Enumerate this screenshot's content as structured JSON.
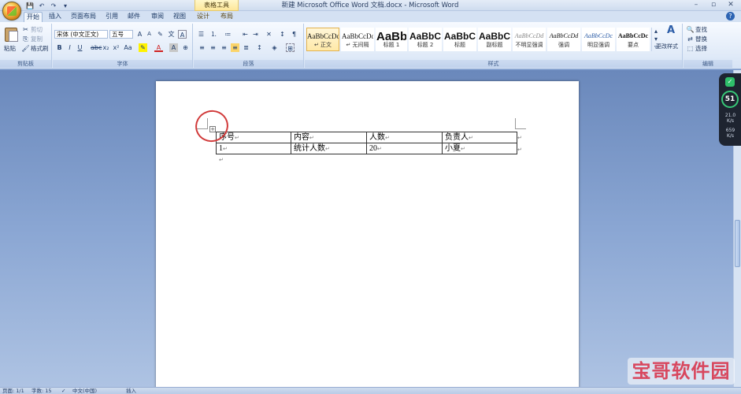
{
  "titlebar": {
    "window_title": "新建 Microsoft Office Word 文档.docx - Microsoft Word",
    "contextual_group": "表格工具",
    "qat": [
      "💾",
      "↶",
      "↷",
      "▾"
    ],
    "controls": [
      "–",
      "▫",
      "✕"
    ]
  },
  "tabs": [
    "开始",
    "插入",
    "页面布局",
    "引用",
    "邮件",
    "审阅",
    "视图",
    "设计",
    "布局"
  ],
  "ribbon": {
    "clipboard": {
      "paste": "粘贴",
      "cut": "剪切",
      "copy": "复制",
      "format_painter": "格式刷",
      "label": "剪贴板"
    },
    "font": {
      "name": "宋体 (中文正文)",
      "size": "五号",
      "label": "字体"
    },
    "paragraph": {
      "label": "段落"
    },
    "styles": {
      "label": "样式",
      "items": [
        {
          "sample": "AaBbCcDd",
          "name": "↵ 正文"
        },
        {
          "sample": "AaBbCcDd",
          "name": "↵ 无间隔"
        },
        {
          "sample": "AaBb",
          "name": "标题 1"
        },
        {
          "sample": "AaBbC",
          "name": "标题 2"
        },
        {
          "sample": "AaBbC",
          "name": "标题"
        },
        {
          "sample": "AaBbC",
          "name": "副标题"
        },
        {
          "sample": "AaBbCcDd",
          "name": "不明显强调"
        },
        {
          "sample": "AaBbCcDd",
          "name": "强调"
        },
        {
          "sample": "AaBbCcDc",
          "name": "明显强调"
        },
        {
          "sample": "AaBbCcDc",
          "name": "要点"
        }
      ],
      "change_styles": "更改样式"
    },
    "editing": {
      "find": "查找",
      "replace": "替换",
      "select": "选择",
      "label": "编辑"
    }
  },
  "table": {
    "rows": [
      [
        "序号",
        "内容",
        "人数",
        "负责人"
      ],
      [
        "1",
        "统计人数",
        "20",
        "小夏"
      ]
    ],
    "cell_mark": "↵"
  },
  "net_widget": {
    "percent": "51",
    "up_rate": "21.0",
    "up_unit": "K/s",
    "down_rate": "659",
    "down_unit": "K/s"
  },
  "statusbar": {
    "page": "页面: 1/1",
    "words": "字数: 15",
    "language": "中文(中国)",
    "mode": "插入"
  },
  "watermark": "宝哥软件园"
}
